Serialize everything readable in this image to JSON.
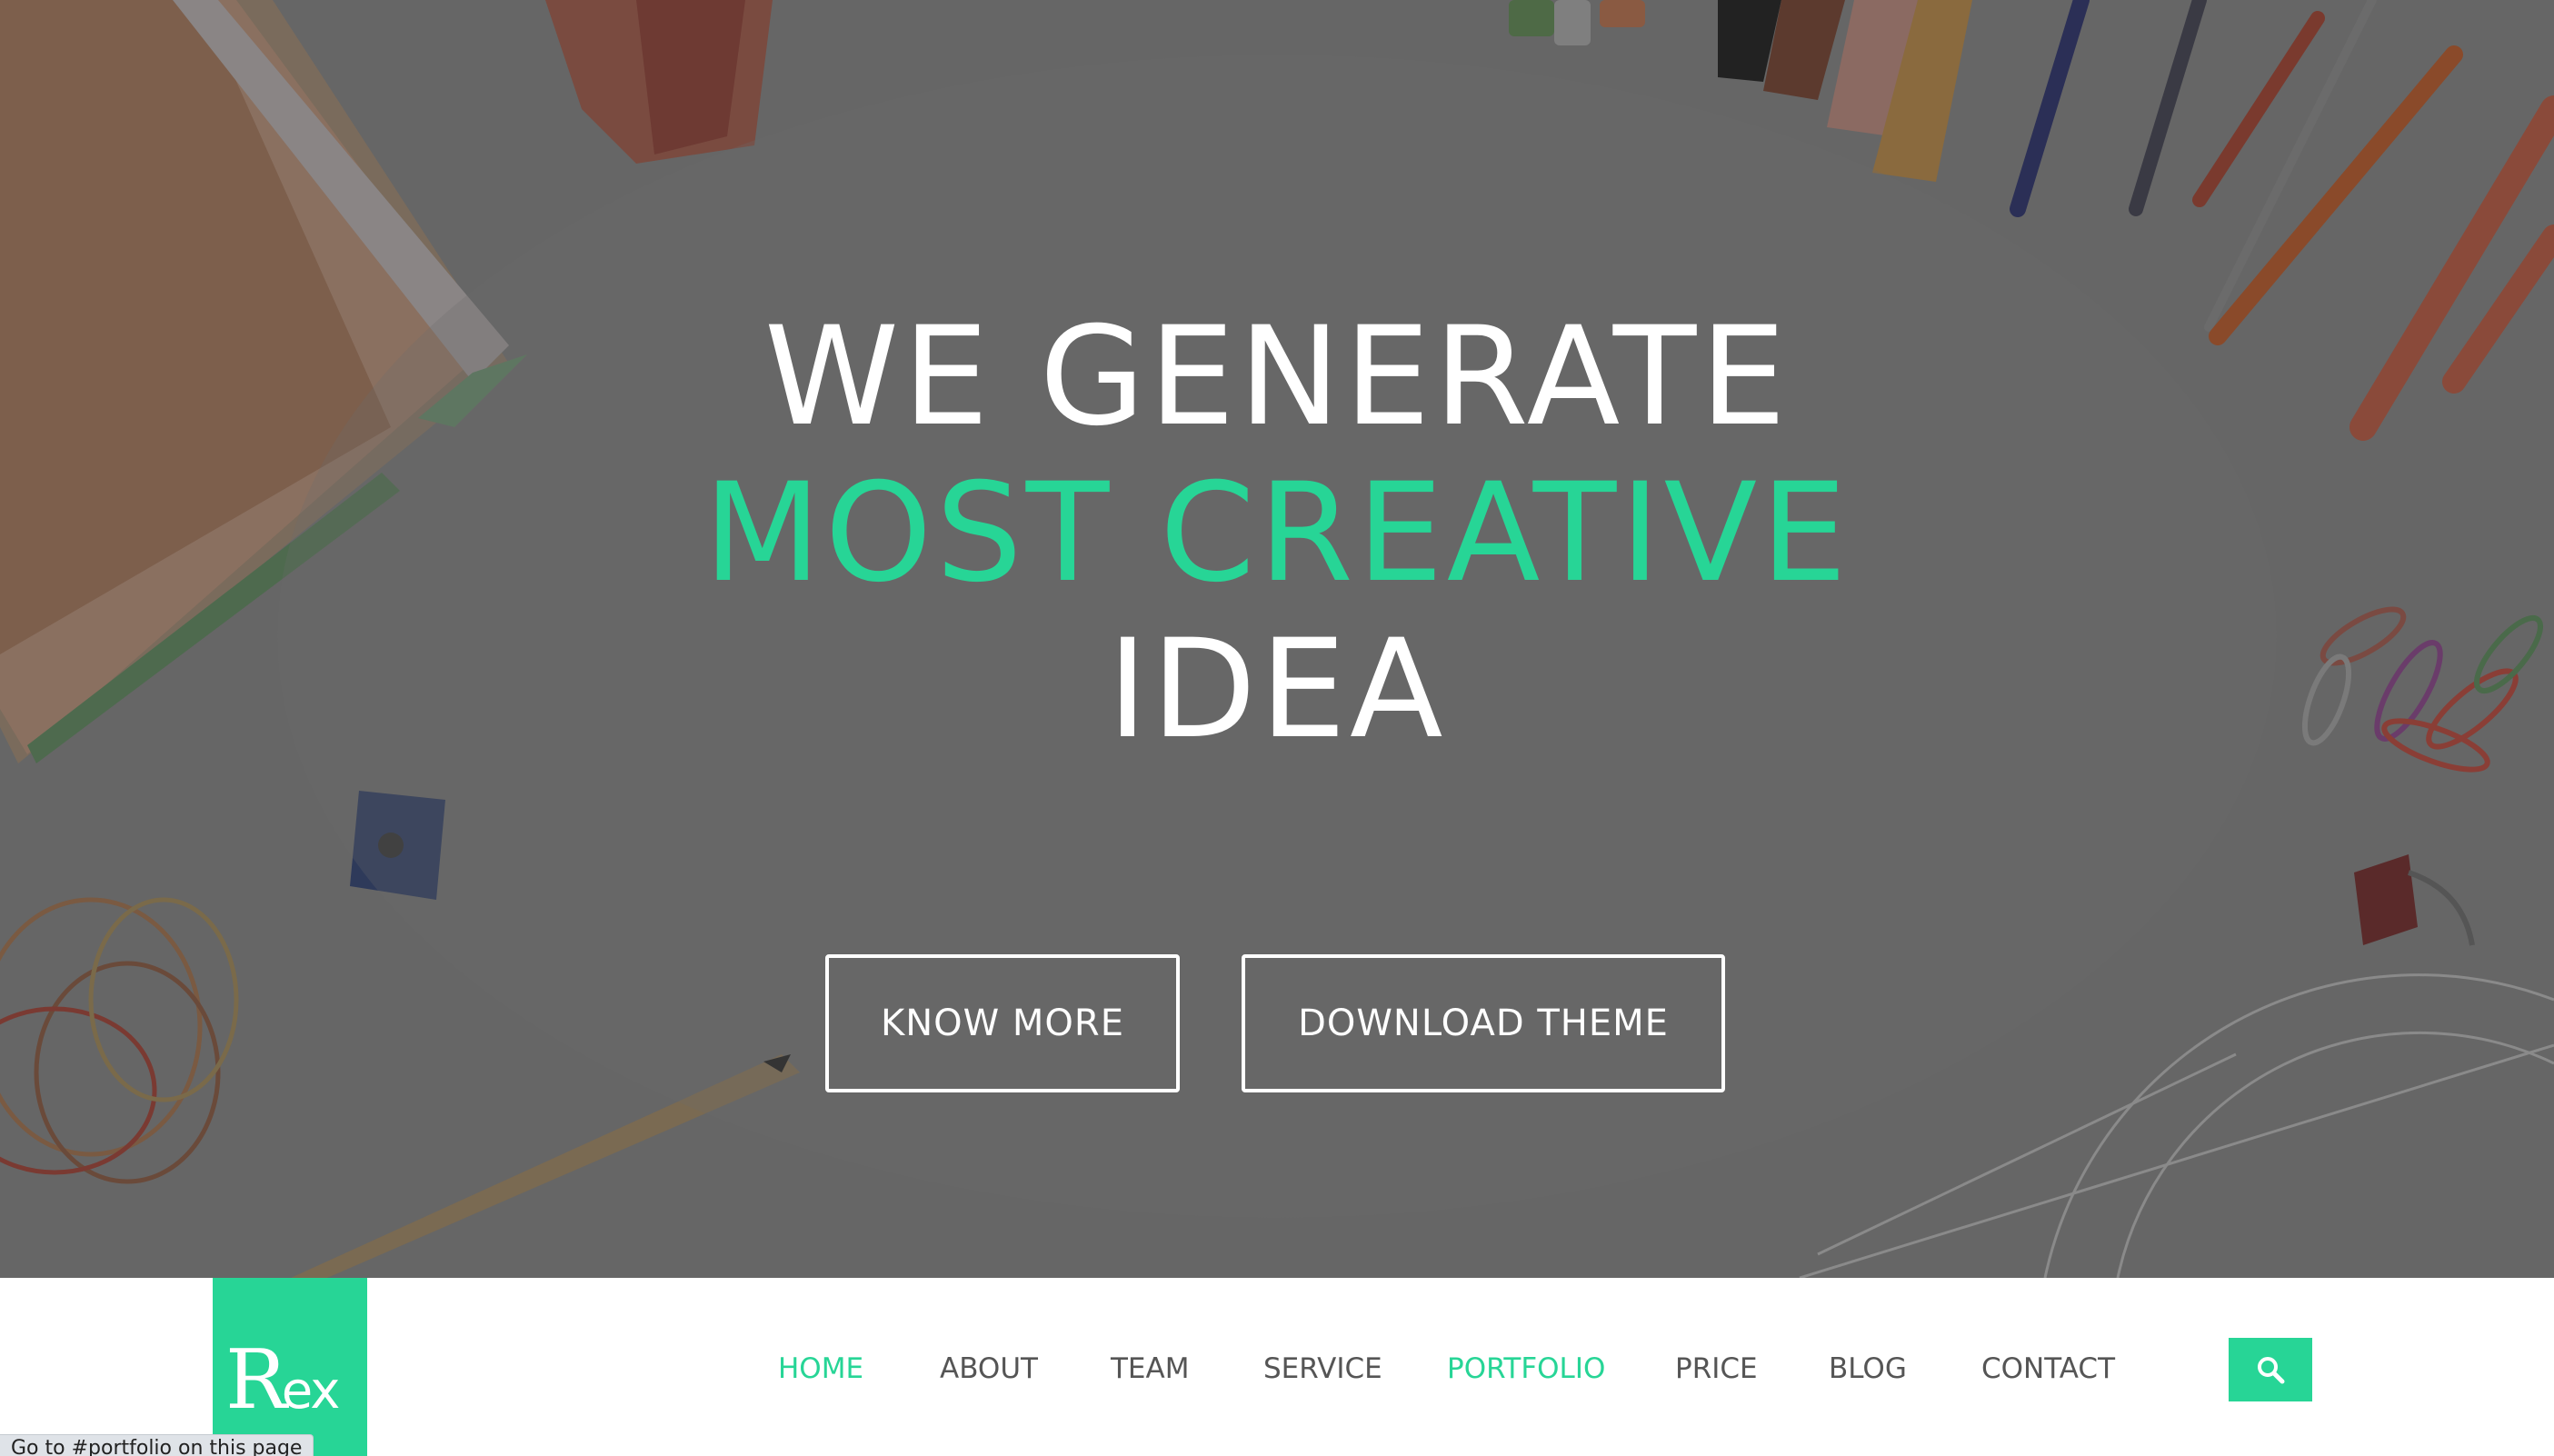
{
  "hero": {
    "headline_line1": "WE GENERATE",
    "headline_line2": "MOST CREATIVE",
    "headline_line3": "IDEA",
    "buttons": [
      {
        "label": "KNOW MORE"
      },
      {
        "label": "DOWNLOAD THEME"
      }
    ]
  },
  "logo": {
    "big": "R",
    "small": "ex"
  },
  "nav": {
    "items": [
      {
        "label": "HOME",
        "active": true
      },
      {
        "label": "ABOUT",
        "active": false
      },
      {
        "label": "TEAM",
        "active": false
      },
      {
        "label": "SERVICE",
        "active": false
      },
      {
        "label": "PORTFOLIO",
        "active": true
      },
      {
        "label": "PRICE",
        "active": false
      },
      {
        "label": "BLOG",
        "active": false
      },
      {
        "label": "CONTACT",
        "active": false
      }
    ],
    "search_icon": "search-icon"
  },
  "status_bar": {
    "text": "Go to #portfolio on this page"
  },
  "colors": {
    "accent": "#27d596",
    "overlay": "#646464",
    "nav_text": "#555555"
  }
}
